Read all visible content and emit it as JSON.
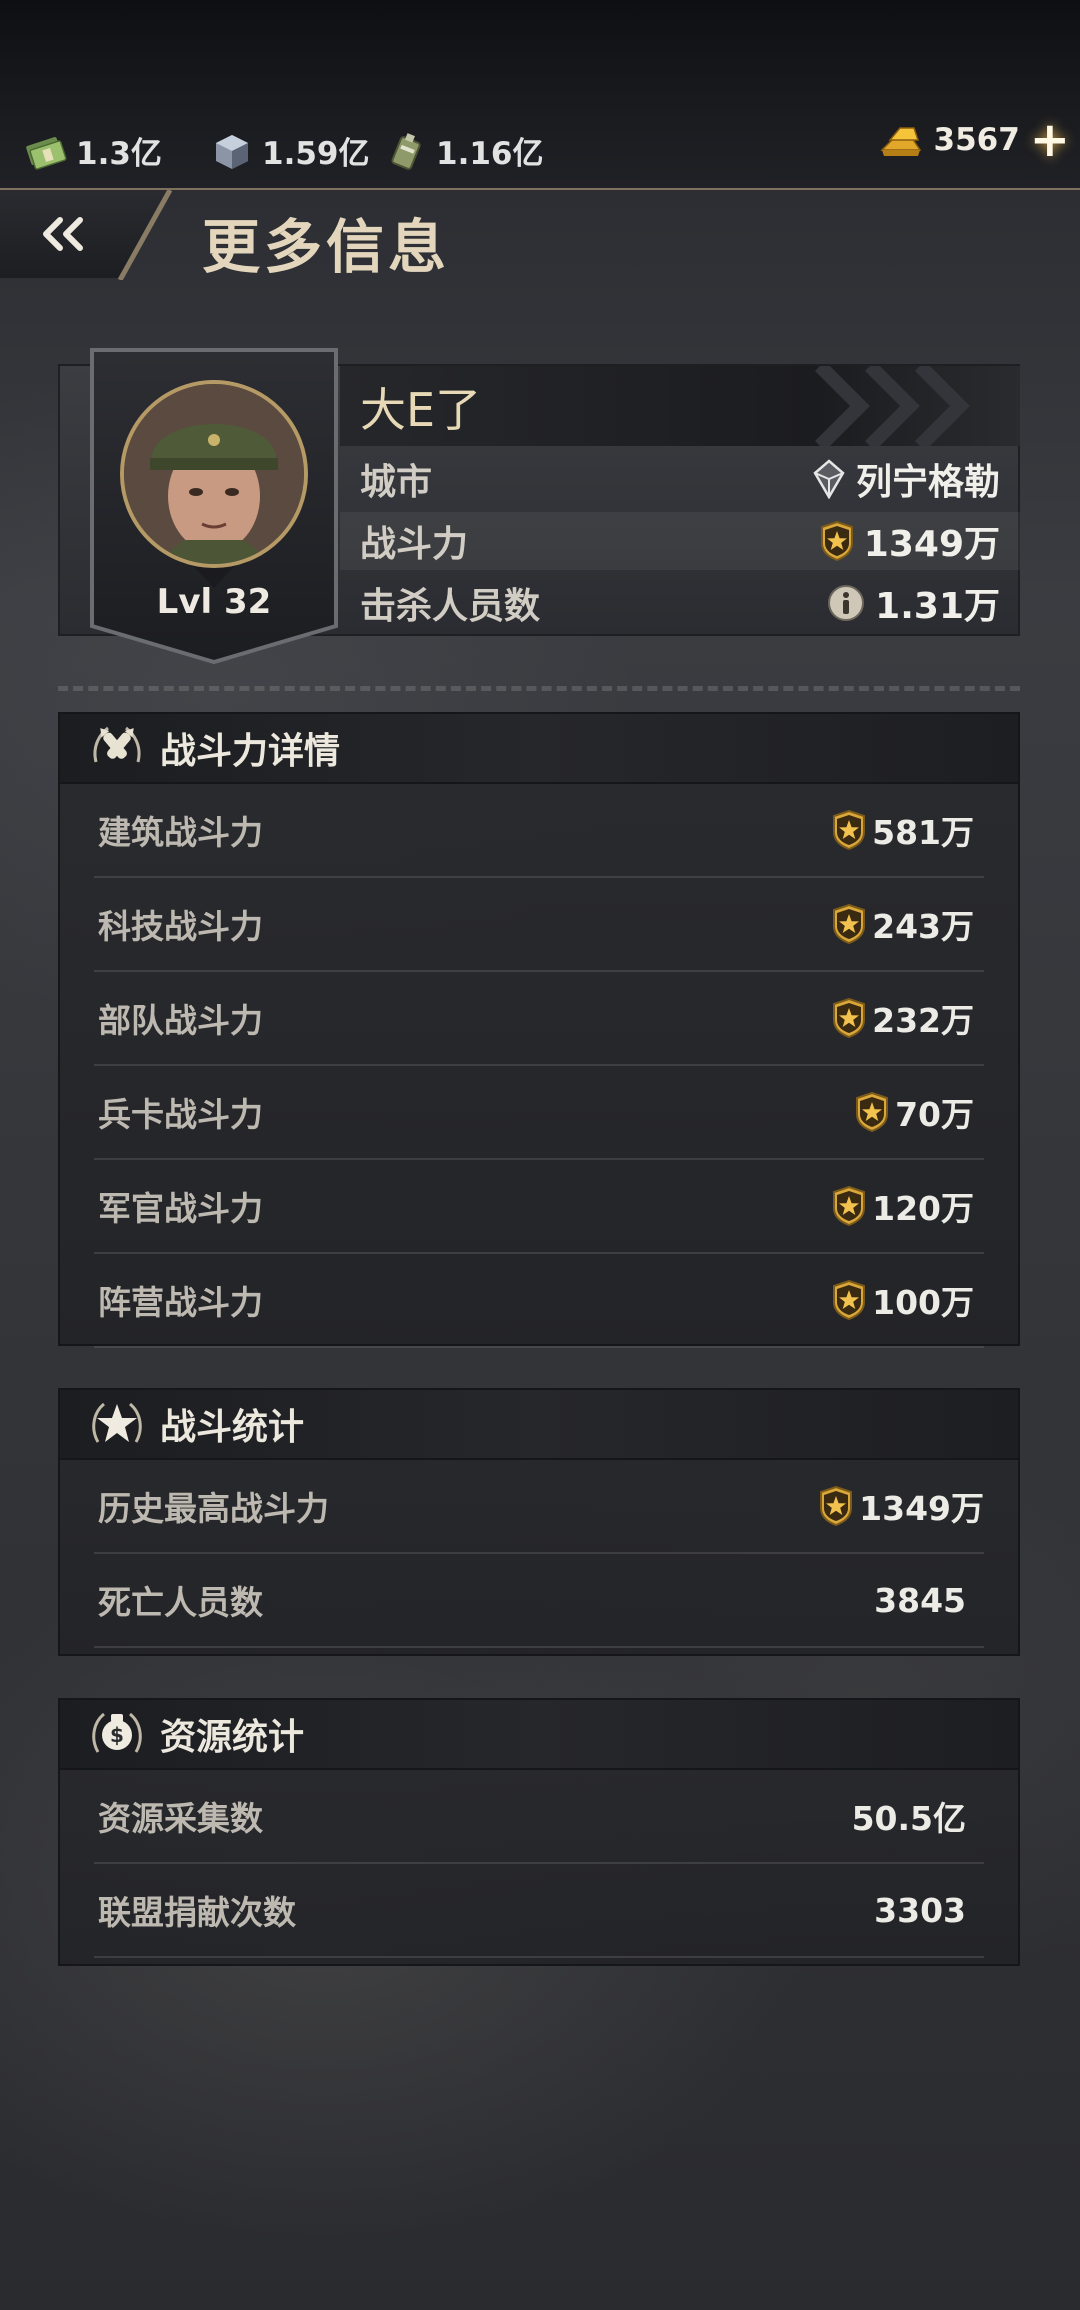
{
  "resources": {
    "cash": "1.3亿",
    "steel": "1.59亿",
    "oil": "1.16亿",
    "gold": "3567"
  },
  "header": {
    "title": "更多信息"
  },
  "profile": {
    "name": "大E了",
    "level": "Lvl 32",
    "rows": [
      {
        "label": "城市",
        "value": "列宁格勒"
      },
      {
        "label": "战斗力",
        "value": "1349万"
      },
      {
        "label": "击杀人员数",
        "value": "1.31万"
      }
    ]
  },
  "power_details": {
    "title": "战斗力详情",
    "rows": [
      {
        "label": "建筑战斗力",
        "value": "581万"
      },
      {
        "label": "科技战斗力",
        "value": "243万"
      },
      {
        "label": "部队战斗力",
        "value": "232万"
      },
      {
        "label": "兵卡战斗力",
        "value": "70万"
      },
      {
        "label": "军官战斗力",
        "value": "120万"
      },
      {
        "label": "阵营战斗力",
        "value": "100万"
      }
    ]
  },
  "battle_stats": {
    "title": "战斗统计",
    "rows": [
      {
        "label": "历史最高战斗力",
        "value": "1349万"
      },
      {
        "label": "死亡人员数",
        "value": "3845"
      }
    ]
  },
  "resource_stats": {
    "title": "资源统计",
    "rows": [
      {
        "label": "资源采集数",
        "value": "50.5亿"
      },
      {
        "label": "联盟捐献次数",
        "value": "3303"
      }
    ]
  },
  "colors": {
    "accent_gold": "#e3d6bc",
    "badge_gold": "#d8a93a",
    "text_light": "#ecebe6"
  }
}
